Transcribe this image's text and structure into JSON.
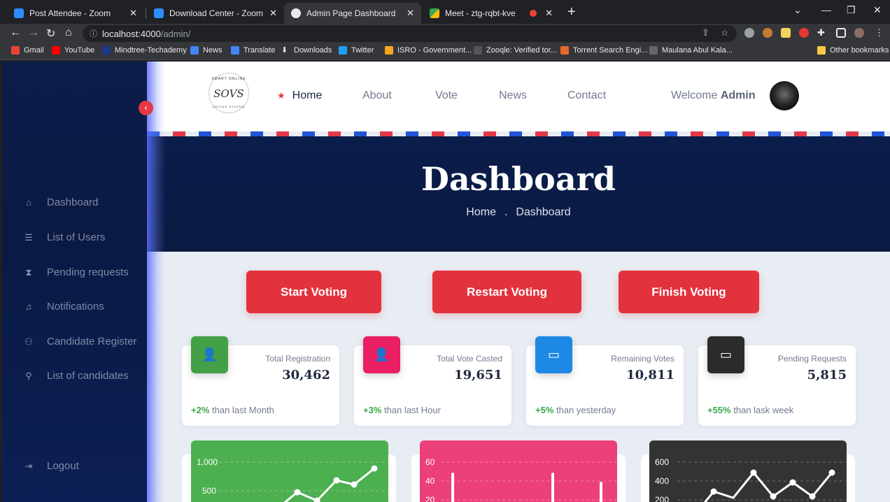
{
  "browser": {
    "tabs": [
      {
        "title": "Post Attendee - Zoom",
        "active": false
      },
      {
        "title": "Download Center - Zoom",
        "active": false
      },
      {
        "title": "Admin Page Dashboard",
        "active": true
      },
      {
        "title": "Meet - ztg-rqbt-kve",
        "active": false
      }
    ],
    "url_host": "localhost:4000",
    "url_path": "/admin/",
    "bookmarks": [
      "Gmail",
      "YouTube",
      "Mindtree-Techademy",
      "News",
      "Translate",
      "Downloads",
      "Twitter",
      "ISRO - Government...",
      "Zooqle: Verified tor...",
      "Torrent Search Engi...",
      "Maulana Abul Kala..."
    ],
    "other_bookmarks": "Other bookmarks"
  },
  "sidebar": {
    "items": [
      {
        "label": "Dashboard",
        "icon": "home-icon"
      },
      {
        "label": "List of Users",
        "icon": "user-list-icon"
      },
      {
        "label": "Pending requests",
        "icon": "hourglass-icon"
      },
      {
        "label": "Notifications",
        "icon": "bell-icon"
      },
      {
        "label": "Candidate Register",
        "icon": "user-add-icon"
      },
      {
        "label": "List of candidates",
        "icon": "user-icon"
      }
    ],
    "logout": "Logout"
  },
  "header": {
    "logo_top": "SMART ONLINE",
    "logo_mark": "SOVS",
    "logo_bottom": "VOTING SYSTEM",
    "nav": [
      "Home",
      "About",
      "Vote",
      "News",
      "Contact"
    ],
    "welcome_prefix": "Welcome",
    "welcome_user": "Admin"
  },
  "hero": {
    "title": "Dashboard",
    "crumb_home": "Home",
    "crumb_sep": ".",
    "crumb_current": "Dashboard"
  },
  "actions": {
    "start": "Start Voting",
    "restart": "Restart Voting",
    "finish": "Finish Voting"
  },
  "stats": [
    {
      "label": "Total Registration",
      "value": "30,462",
      "pct": "+2%",
      "suffix": "than last Month",
      "color": "#43a047"
    },
    {
      "label": "Total Vote Casted",
      "value": "19,651",
      "pct": "+3%",
      "suffix": "than last Hour",
      "color": "#e91e63"
    },
    {
      "label": "Remaining Votes",
      "value": "10,811",
      "pct": "+5%",
      "suffix": "than yesterday",
      "color": "#1e88e5"
    },
    {
      "label": "Pending Requests",
      "value": "5,815",
      "pct": "+55%",
      "suffix": "than lask week",
      "color": "#2b2b2b"
    }
  ],
  "charts": {
    "green": {
      "ticks": [
        "1,000",
        "500"
      ],
      "color": "#4caf50"
    },
    "pink": {
      "ticks": [
        "60",
        "40",
        "20"
      ],
      "color": "#ec407a"
    },
    "dark": {
      "ticks": [
        "600",
        "400",
        "200"
      ],
      "color": "#333333"
    }
  }
}
